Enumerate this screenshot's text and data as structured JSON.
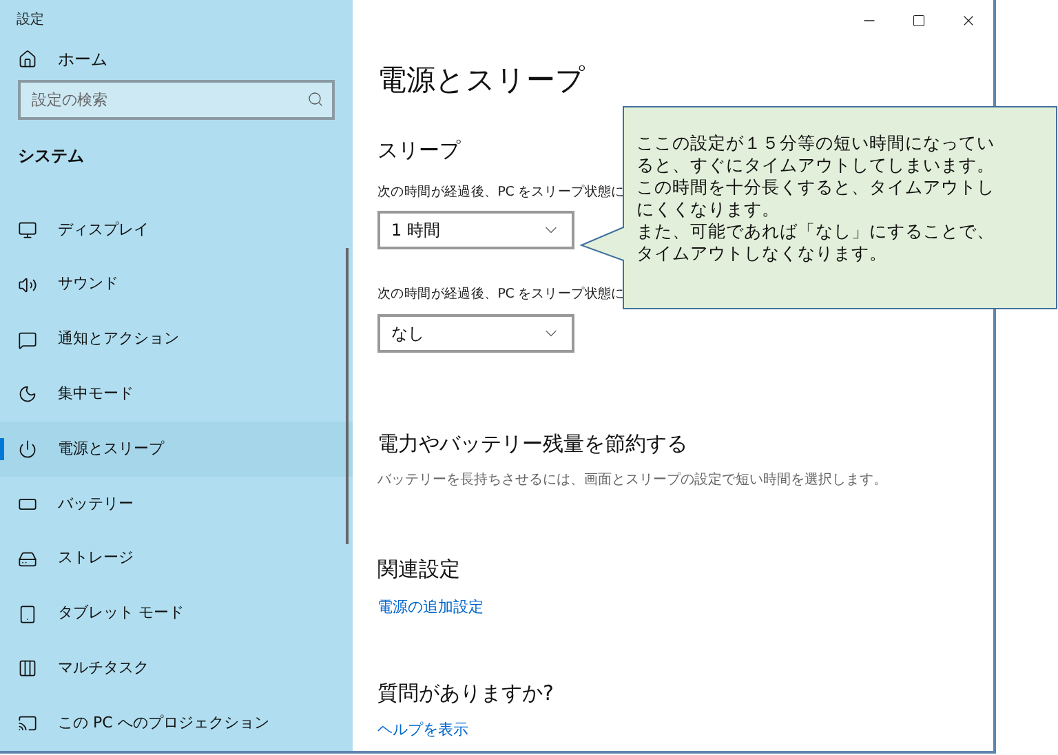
{
  "window": {
    "title": "設定"
  },
  "sidebar": {
    "home": "ホーム",
    "search": {
      "placeholder": "設定の検索"
    },
    "section": "システム",
    "items": [
      {
        "label": "ディスプレイ",
        "selected": false
      },
      {
        "label": "サウンド",
        "selected": false
      },
      {
        "label": "通知とアクション",
        "selected": false
      },
      {
        "label": "集中モード",
        "selected": false
      },
      {
        "label": "電源とスリープ",
        "selected": true
      },
      {
        "label": "バッテリー",
        "selected": false
      },
      {
        "label": "ストレージ",
        "selected": false
      },
      {
        "label": "タブレット モード",
        "selected": false
      },
      {
        "label": "マルチタスク",
        "selected": false
      },
      {
        "label": "この PC へのプロジェクション",
        "selected": false
      }
    ]
  },
  "page": {
    "title": "電源とスリープ",
    "sleep": {
      "heading": "スリープ",
      "settings": [
        {
          "label": "次の時間が経過後、PC をスリープ状態に",
          "value": "1 時間"
        },
        {
          "label": "次の時間が経過後、PC をスリープ状態に",
          "value": "なし"
        }
      ]
    },
    "save": {
      "heading": "電力やバッテリー残量を節約する",
      "description": "バッテリーを長持ちさせるには、画面とスリープの設定で短い時間を選択します。"
    },
    "related": {
      "heading": "関連設定",
      "link": "電源の追加設定"
    },
    "help": {
      "heading": "質問がありますか?",
      "link": "ヘルプを表示"
    }
  },
  "callout": {
    "lines": [
      "ここの設定が１５分等の短い時間になってい",
      "ると、すぐにタイムアウトしてしまいます。",
      "この時間を十分長くすると、タイムアウトし",
      "にくくなります。",
      "また、可能であれば「なし」にすることで、",
      "タイムアウトしなくなります。"
    ]
  }
}
